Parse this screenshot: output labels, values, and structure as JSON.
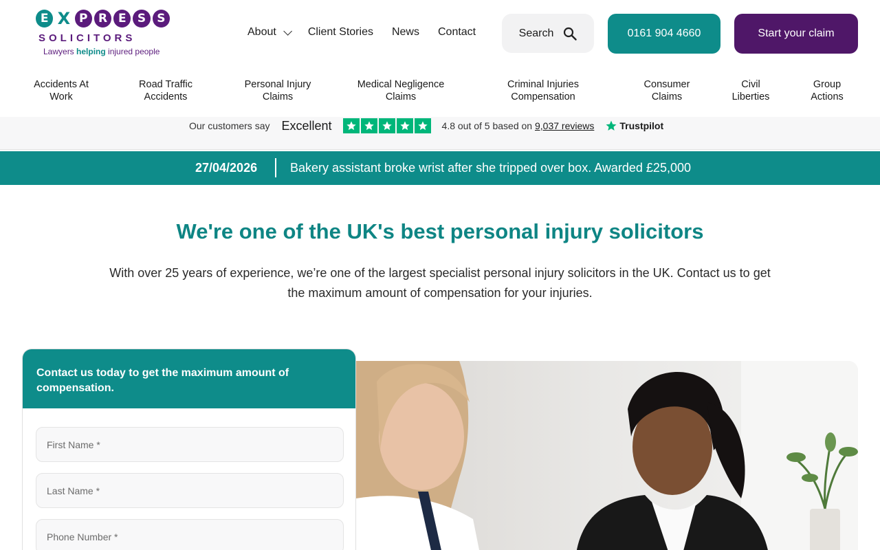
{
  "brand": {
    "logo_letters": [
      "E",
      "X",
      "P",
      "R",
      "E",
      "S",
      "S"
    ],
    "logo_word": "SOLICITORS",
    "tagline_a": "Lawyers ",
    "tagline_b": "helping",
    "tagline_c": " injured people"
  },
  "topnav": {
    "items": [
      {
        "label": "About",
        "has_dropdown": true
      },
      {
        "label": "Client Stories"
      },
      {
        "label": "News"
      },
      {
        "label": "Contact"
      }
    ],
    "search_label": "Search",
    "phone_label": "0161 904 4660",
    "claim_label": "Start your claim",
    "colors": {
      "teal": "#0e8c8a",
      "purple": "#4f1768"
    }
  },
  "categories": [
    {
      "line1": "Accidents At",
      "line2": "Work"
    },
    {
      "line1": "Road Traffic",
      "line2": "Accidents"
    },
    {
      "line1": "Personal Injury",
      "line2": "Claims"
    },
    {
      "line1": "Medical Negligence",
      "line2": "Claims"
    },
    {
      "line1": "Criminal Injuries",
      "line2": "Compensation"
    },
    {
      "line1": "Consumer",
      "line2": "Claims"
    },
    {
      "line1": "Civil",
      "line2": "Liberties"
    },
    {
      "line1": "Group",
      "line2": "Actions"
    }
  ],
  "trustpilot": {
    "intro": "Our customers say",
    "rating_word": "Excellent",
    "stars": 5,
    "score_text": "4.8 out of 5 based on ",
    "reviews_link": "9,037 reviews",
    "brand": "Trustpilot",
    "star_color": "#00b67a"
  },
  "ticker": {
    "date": "27/04/2026",
    "headline": "Bakery assistant broke wrist after she tripped over box. Awarded £25,000"
  },
  "hero": {
    "title": "We're one of the UK's best personal injury solicitors",
    "description": "With over 25 years of experience, we’re one of the largest specialist personal injury solicitors in the UK. Contact us to get the maximum amount of compensation for your injuries."
  },
  "form": {
    "heading": "Contact us today to get the maximum amount of compensation.",
    "first_name_placeholder": "First Name *",
    "last_name_placeholder": "Last Name *",
    "phone_placeholder": "Phone Number *"
  }
}
